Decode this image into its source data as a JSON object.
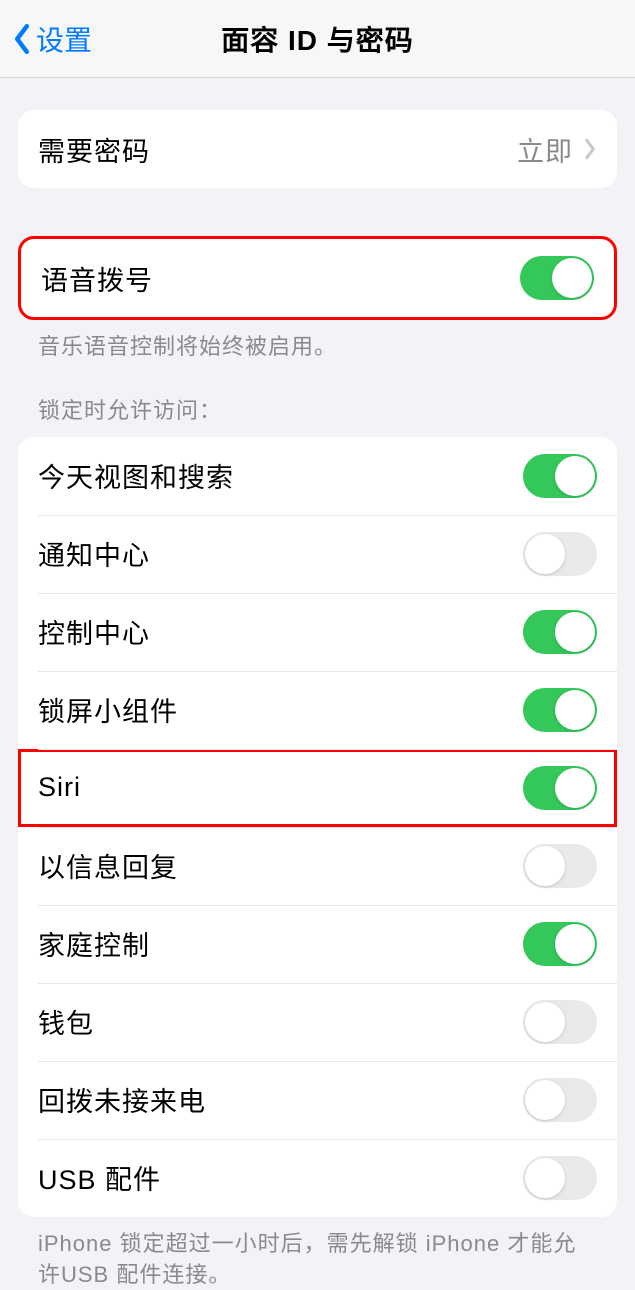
{
  "nav": {
    "back_label": "设置",
    "title": "面容 ID 与密码"
  },
  "passcode": {
    "label": "需要密码",
    "value": "立即"
  },
  "voice_dial": {
    "label": "语音拨号",
    "on": true,
    "footer": "音乐语音控制将始终被启用。"
  },
  "lock_access": {
    "header": "锁定时允许访问：",
    "items": [
      {
        "label": "今天视图和搜索",
        "on": true
      },
      {
        "label": "通知中心",
        "on": false
      },
      {
        "label": "控制中心",
        "on": true
      },
      {
        "label": "锁屏小组件",
        "on": true
      },
      {
        "label": "Siri",
        "on": true
      },
      {
        "label": "以信息回复",
        "on": false
      },
      {
        "label": "家庭控制",
        "on": true
      },
      {
        "label": "钱包",
        "on": false
      },
      {
        "label": "回拨未接来电",
        "on": false
      },
      {
        "label": "USB 配件",
        "on": false
      }
    ],
    "footer": "iPhone 锁定超过一小时后，需先解锁 iPhone 才能允许USB 配件连接。"
  },
  "highlights": [
    0,
    4
  ]
}
